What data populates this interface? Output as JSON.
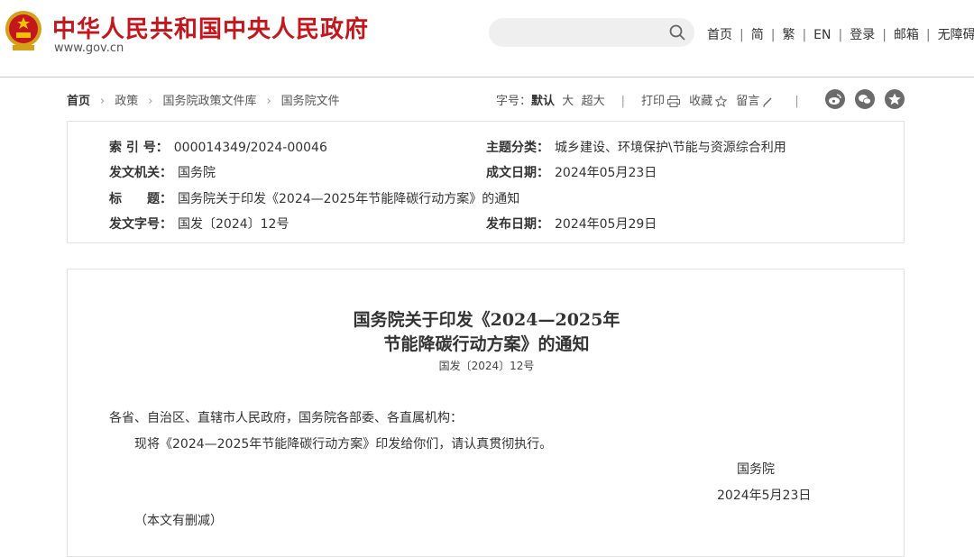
{
  "header": {
    "site_title": "中华人民共和国中央人民政府",
    "site_url": "www.gov.cn",
    "search_placeholder": "",
    "nav": [
      "首页",
      "简",
      "繁",
      "EN",
      "登录",
      "邮箱",
      "无障碍"
    ],
    "brand_color": "#c4161c"
  },
  "breadcrumb": [
    "首页",
    "政策",
    "国务院政策文件库",
    "国务院文件"
  ],
  "tools": {
    "font_label": "字号：",
    "font_default": "默认",
    "font_large": "大",
    "font_xlarge": "超大",
    "print": "打印",
    "favorite": "收藏",
    "comment": "留言"
  },
  "share_icons": [
    "weibo-icon",
    "wechat-icon",
    "favorite-star-icon"
  ],
  "meta": {
    "index_label": "索 引 号：",
    "index_value": "000014349/2024-00046",
    "category_label": "主题分类：",
    "category_value": "城乡建设、环境保护\\节能与资源综合利用",
    "issuer_label": "发文机关：",
    "issuer_value": "国务院",
    "date_written_label": "成文日期：",
    "date_written_value": "2024年05月23日",
    "title_label": "标　　题：",
    "title_value": "国务院关于印发《2024—2025年节能降碳行动方案》的通知",
    "doc_no_label": "发文字号：",
    "doc_no_value": "国发〔2024〕12号",
    "publish_label": "发布日期：",
    "publish_value": "2024年05月29日"
  },
  "article": {
    "title_line1": "国务院关于印发《2024—2025年",
    "title_line2": "节能降碳行动方案》的通知",
    "doc_no": "国发〔2024〕12号",
    "salutation": "各省、自治区、直辖市人民政府，国务院各部委、各直属机构：",
    "body": "现将《2024—2025年节能降碳行动方案》印发给你们，请认真贯彻执行。",
    "signature": "国务院",
    "date": "2024年5月23日",
    "note": "（本文有删减）"
  }
}
